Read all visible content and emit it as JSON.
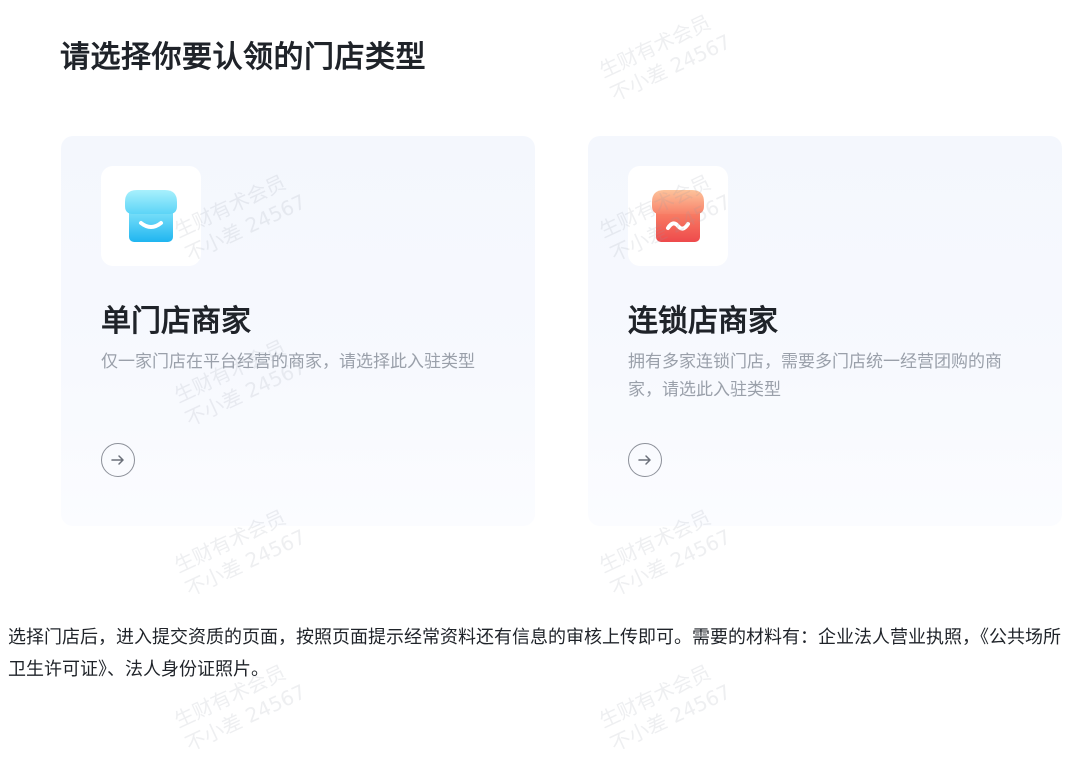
{
  "page": {
    "title": "请选择你要认领的门店类型",
    "footer": "选择门店后，进入提交资质的页面，按照页面提示经常资料还有信息的审核上传即可。需要的材料有：企业法人营业执照，《公共场所卫生许可证》、法人身份证照片。"
  },
  "cards": [
    {
      "title": "单门店商家",
      "description": "仅一家门店在平台经营的商家，请选择此入驻类型",
      "icon": "store-smile-icon",
      "icon_color": "#3dc6f4"
    },
    {
      "title": "连锁店商家",
      "description": "拥有多家连锁门店，需要多门店统一经营团购的商家，请选此入驻类型",
      "icon": "store-wave-icon",
      "icon_color": "#f2624a"
    }
  ],
  "watermark": {
    "line1": "生财有术会员",
    "line2": "不小差 24567"
  },
  "colors": {
    "card_background": "#f4f7fd",
    "title_text": "#1f2329",
    "desc_text": "#9aa0aa"
  }
}
